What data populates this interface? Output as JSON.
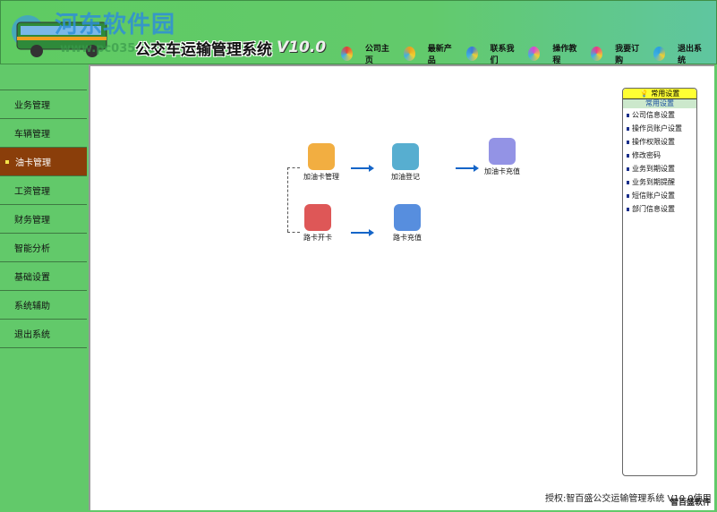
{
  "header": {
    "watermark": "河东软件园",
    "watermark_url": "www.pc0359.cn",
    "title": "公交车运输管理系统",
    "version": "V10.0",
    "nav": [
      {
        "label": "公司主页",
        "icon": "globe-icon",
        "color": "#e0403a"
      },
      {
        "label": "最新产品",
        "icon": "flower-icon",
        "color": "#e8a020"
      },
      {
        "label": "联系我们",
        "icon": "link-icon",
        "color": "#3a7ad8"
      },
      {
        "label": "操作教程",
        "icon": "star-icon",
        "color": "#d84ad0"
      },
      {
        "label": "我要订购",
        "icon": "color-wheel-icon",
        "color": "#e83a8a"
      },
      {
        "label": "退出系统",
        "icon": "search-icon",
        "color": "#2aa0e0"
      }
    ]
  },
  "sidebar": {
    "items": [
      {
        "label": "业务管理"
      },
      {
        "label": "车辆管理"
      },
      {
        "label": "油卡管理",
        "active": true
      },
      {
        "label": "工资管理"
      },
      {
        "label": "财务管理"
      },
      {
        "label": "智能分析"
      },
      {
        "label": "基础设置"
      },
      {
        "label": "系统辅助"
      },
      {
        "label": "退出系统"
      }
    ]
  },
  "flow": {
    "nodes": [
      {
        "label": "加油卡管理",
        "icon": "coins-icon"
      },
      {
        "label": "加油登记",
        "icon": "car-icon"
      },
      {
        "label": "加油卡充值",
        "icon": "notepad-icon"
      },
      {
        "label": "路卡开卡",
        "icon": "calendar-icon"
      },
      {
        "label": "路卡充值",
        "icon": "pen-icon"
      }
    ]
  },
  "panel": {
    "title": "常用设置",
    "subtitle": "常用设置",
    "items": [
      "公司信息设置",
      "操作员账户设置",
      "操作权限设置",
      "修改密码",
      "业务到期设置",
      "业务到期提醒",
      "短信账户设置",
      "部门信息设置"
    ]
  },
  "footer": {
    "text": "授权:智百盛公交运输管理系统 V10.0使用",
    "brand": "智百盛软件"
  }
}
